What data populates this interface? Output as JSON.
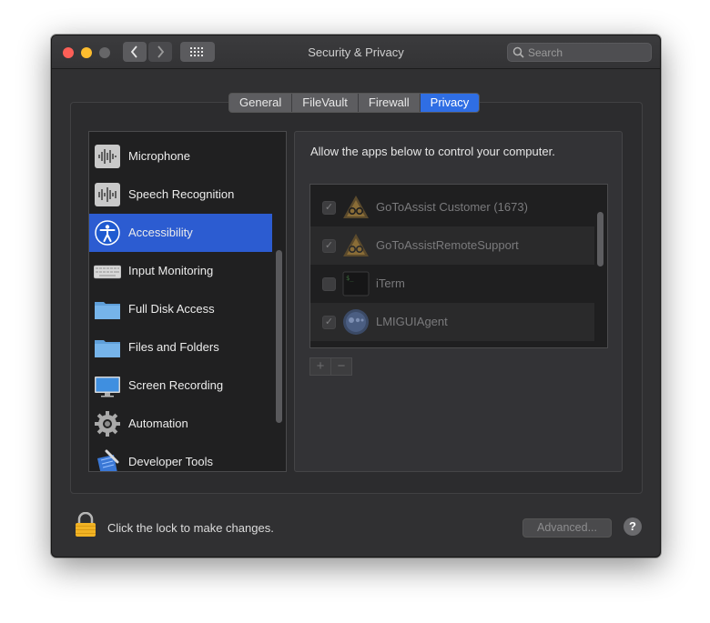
{
  "window": {
    "title": "Security & Privacy"
  },
  "search": {
    "placeholder": "Search"
  },
  "tabs": [
    {
      "label": "General"
    },
    {
      "label": "FileVault"
    },
    {
      "label": "Firewall"
    },
    {
      "label": "Privacy",
      "selected": true
    }
  ],
  "sidebar": {
    "items": [
      {
        "label": "Microphone",
        "icon": "microphone-waveform-icon"
      },
      {
        "label": "Speech Recognition",
        "icon": "speech-waveform-icon"
      },
      {
        "label": "Accessibility",
        "icon": "accessibility-icon",
        "selected": true
      },
      {
        "label": "Input Monitoring",
        "icon": "keyboard-icon"
      },
      {
        "label": "Full Disk Access",
        "icon": "folder-icon"
      },
      {
        "label": "Files and Folders",
        "icon": "folder-icon"
      },
      {
        "label": "Screen Recording",
        "icon": "display-icon"
      },
      {
        "label": "Automation",
        "icon": "gear-icon"
      },
      {
        "label": "Developer Tools",
        "icon": "developer-tools-icon"
      }
    ]
  },
  "panel": {
    "description": "Allow the apps below to control your computer.",
    "apps": [
      {
        "name": "GoToAssist Customer (1673)",
        "checked": true,
        "icon": "gotoassist-icon"
      },
      {
        "name": "GoToAssistRemoteSupport",
        "checked": true,
        "icon": "gotoassist-icon"
      },
      {
        "name": "iTerm",
        "checked": false,
        "icon": "terminal-icon"
      },
      {
        "name": "LMIGUIAgent",
        "checked": true,
        "icon": "lmi-agent-icon"
      }
    ],
    "add_label": "+",
    "remove_label": "−"
  },
  "footer": {
    "lock_text": "Click the lock to make changes.",
    "advanced_label": "Advanced...",
    "help_label": "?"
  },
  "colors": {
    "accent": "#2c5cd1",
    "tab_active": "#2f6ee4",
    "close": "#fc5f57",
    "minimize": "#fcbc2e"
  }
}
